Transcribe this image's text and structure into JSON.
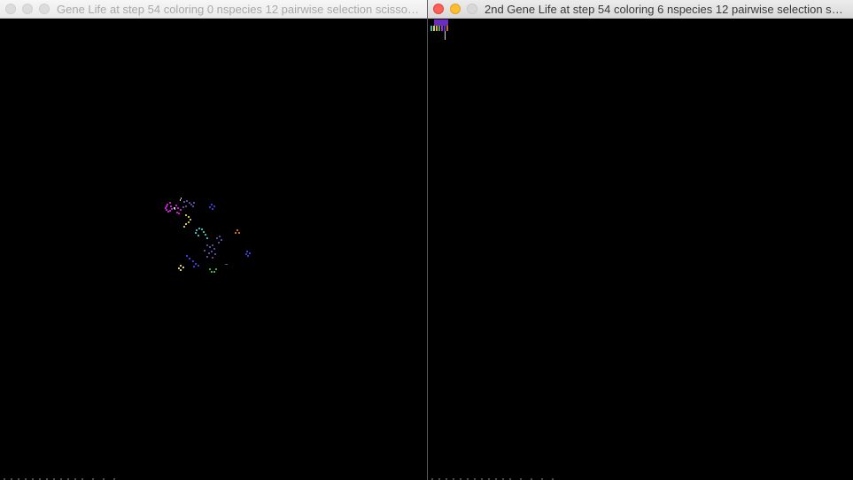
{
  "windows": {
    "left": {
      "title": "Gene Life at step 54 coloring 0 nspecies 12 pairwise selection scissors-..."
    },
    "right": {
      "title": "2nd Gene Life at step 54 coloring 6 nspecies 12 pairwise selection sciss..."
    }
  },
  "colors": {
    "background": "#000000",
    "close": "#fe5f57",
    "minimize": "#febc2e",
    "species": [
      "#c21bc8",
      "#3b3bd8",
      "#c8b84a",
      "#36b7b0",
      "#3fae3f",
      "#c86a1a",
      "#5b4a9a",
      "#d8d8d8"
    ]
  }
}
